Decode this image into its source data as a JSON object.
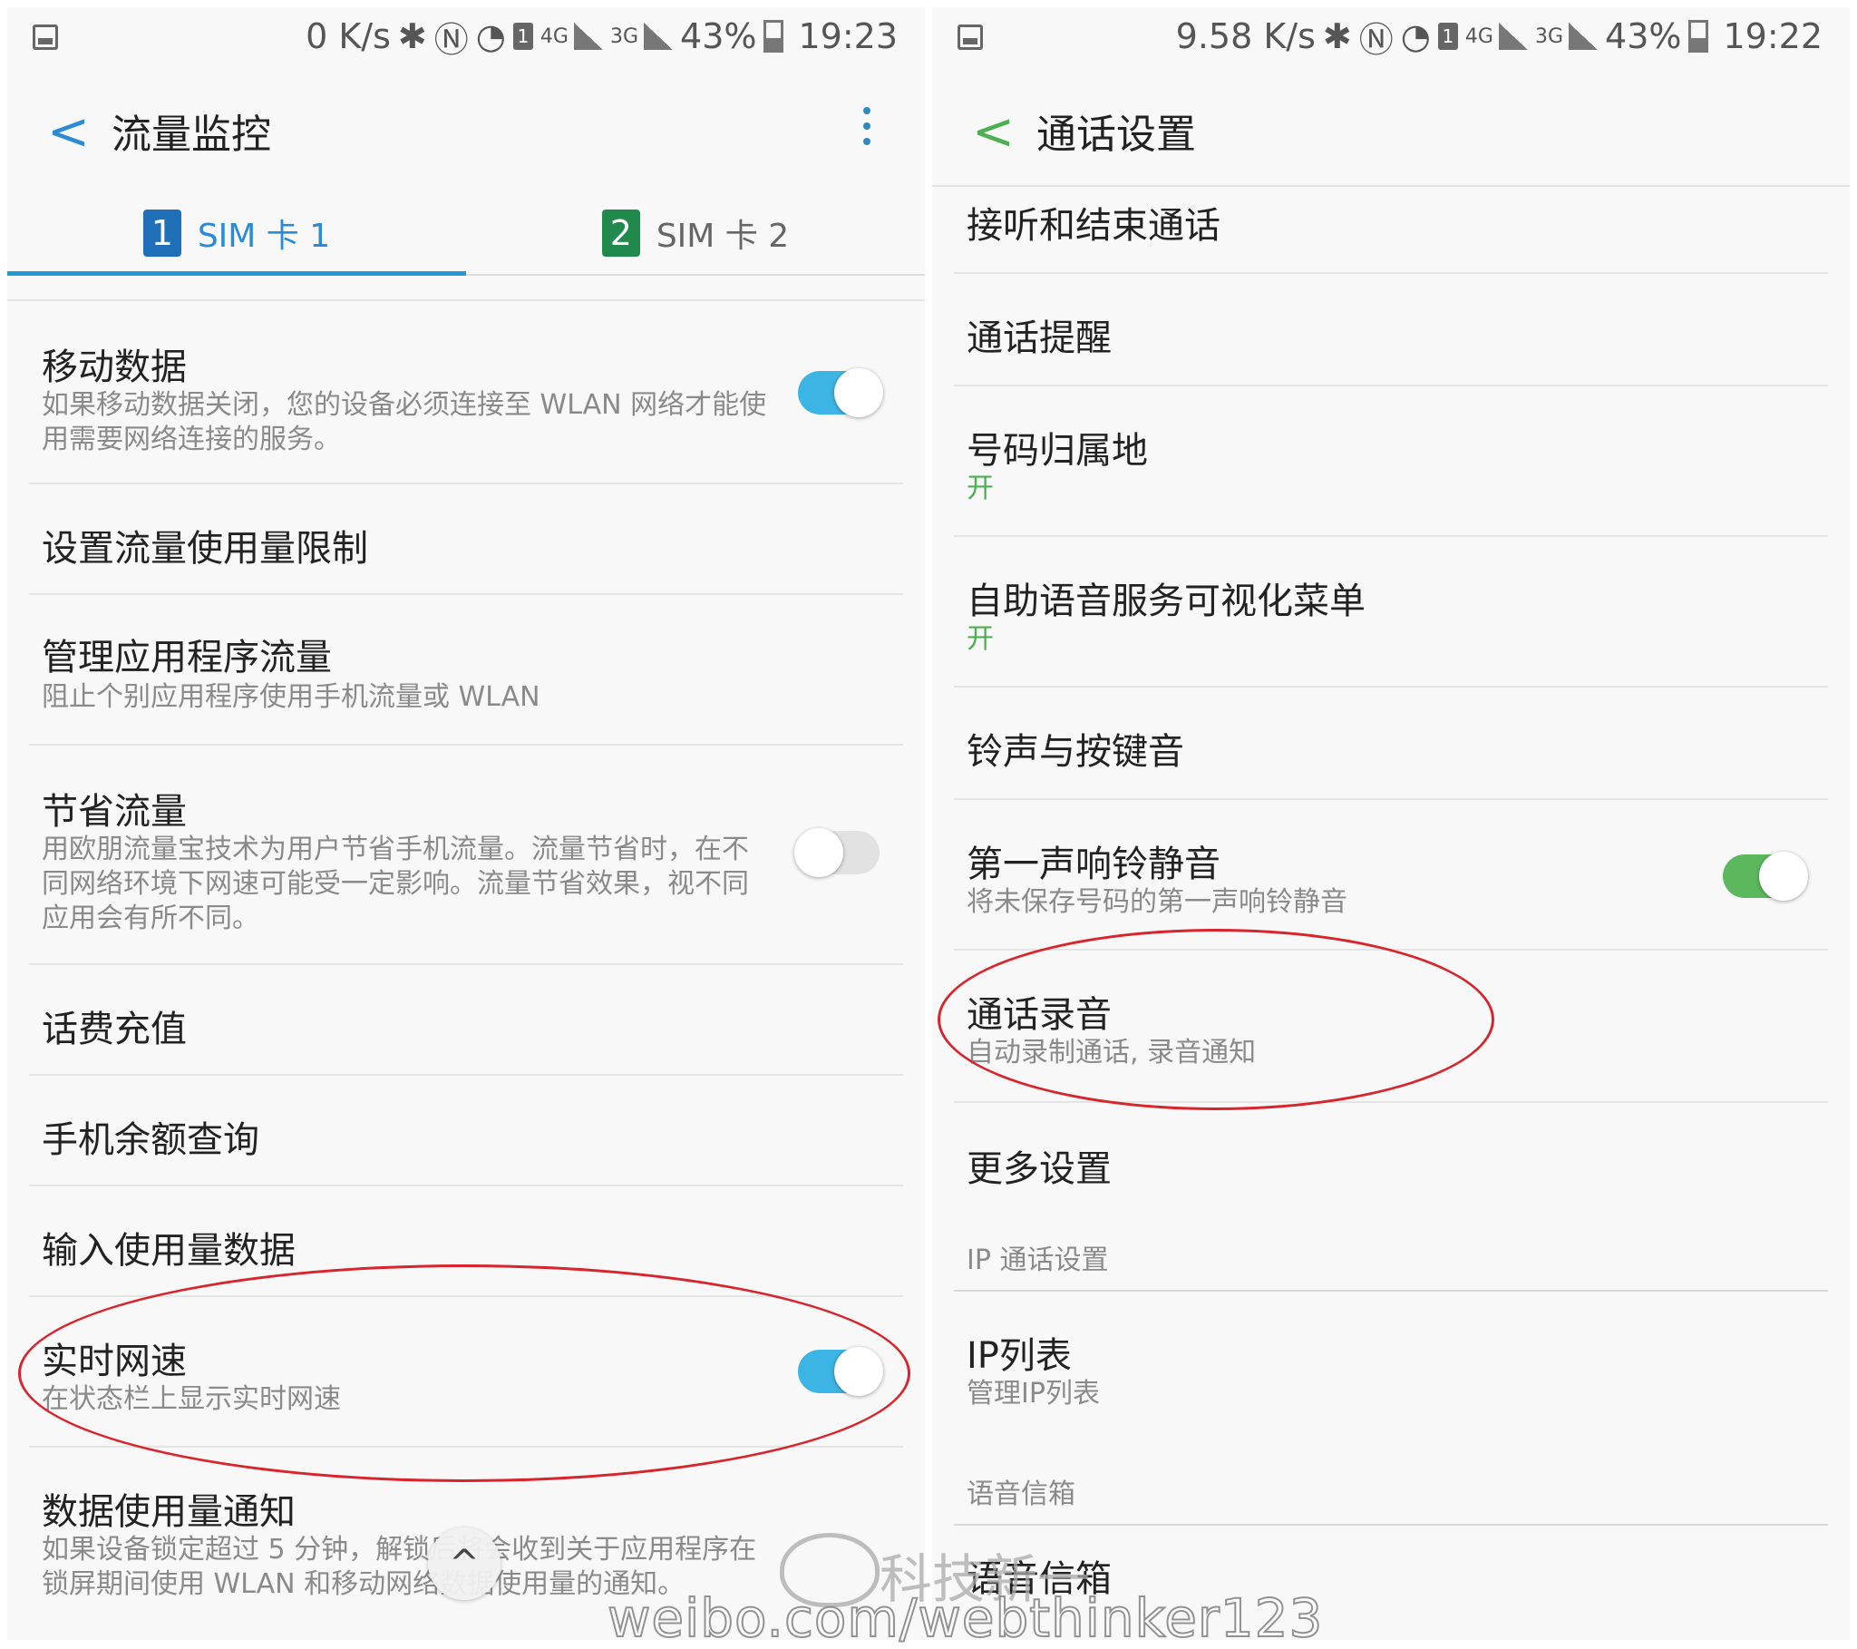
{
  "left": {
    "status": {
      "speed": "0 K/s",
      "net4g": "4G",
      "net3g": "3G",
      "sim": "1",
      "battery": "43%",
      "time": "19:23"
    },
    "appbar": {
      "back": "<",
      "title": "流量监控"
    },
    "tabs": [
      {
        "num": "1",
        "label": "SIM 卡 1"
      },
      {
        "num": "2",
        "label": "SIM 卡 2"
      }
    ],
    "items": [
      {
        "title": "移动数据",
        "sub": "如果移动数据关闭，您的设备必须连接至 WLAN 网络才能使用需要网络连接的服务。",
        "toggle": "on"
      },
      {
        "title": "设置流量使用量限制"
      },
      {
        "title": "管理应用程序流量",
        "sub": "阻止个别应用程序使用手机流量或 WLAN"
      },
      {
        "title": "节省流量",
        "sub": "用欧朋流量宝技术为用户节省手机流量。流量节省时，在不同网络环境下网速可能受一定影响。流量节省效果，视不同应用会有所不同。",
        "toggle": "off"
      },
      {
        "title": "话费充值"
      },
      {
        "title": "手机余额查询"
      },
      {
        "title": "输入使用量数据"
      },
      {
        "title": "实时网速",
        "sub": "在状态栏上显示实时网速",
        "toggle": "on"
      },
      {
        "title": "数据使用量通知",
        "sub": "如果设备锁定超过 5 分钟，解锁后将会收到关于应用程序在锁屏期间使用 WLAN 和移动网络数据使用量的通知。"
      }
    ],
    "scroll_up": "^"
  },
  "right": {
    "status": {
      "speed": "9.58 K/s",
      "net4g": "4G",
      "net3g": "3G",
      "sim": "1",
      "battery": "43%",
      "time": "19:22"
    },
    "appbar": {
      "back": "<",
      "title": "通话设置"
    },
    "items": [
      {
        "title": "接听和结束通话"
      },
      {
        "title": "通话提醒"
      },
      {
        "title": "号码归属地",
        "sub": "开"
      },
      {
        "title": "自助语音服务可视化菜单",
        "sub": "开"
      },
      {
        "title": "铃声与按键音"
      },
      {
        "title": "第一声响铃静音",
        "sub": "将未保存号码的第一声响铃静音",
        "toggle": "on"
      },
      {
        "title": "通话录音",
        "sub": "自动录制通话, 录音通知"
      },
      {
        "title": "更多设置"
      }
    ],
    "section_ip": "IP 通话设置",
    "ip_item": {
      "title": "IP列表",
      "sub": "管理IP列表"
    },
    "section_voicemail": "语音信箱",
    "voicemail_item": {
      "title": "语音信箱"
    }
  },
  "watermark": {
    "name": "科技新一",
    "url": "weibo.com/webthinker123"
  },
  "colors": {
    "accent_blue": "#1f9ad6",
    "toggle_blue": "#3cb5e4",
    "toggle_green": "#5cb85c",
    "status_green": "#4caf50",
    "annotation_red": "#d9242c"
  }
}
